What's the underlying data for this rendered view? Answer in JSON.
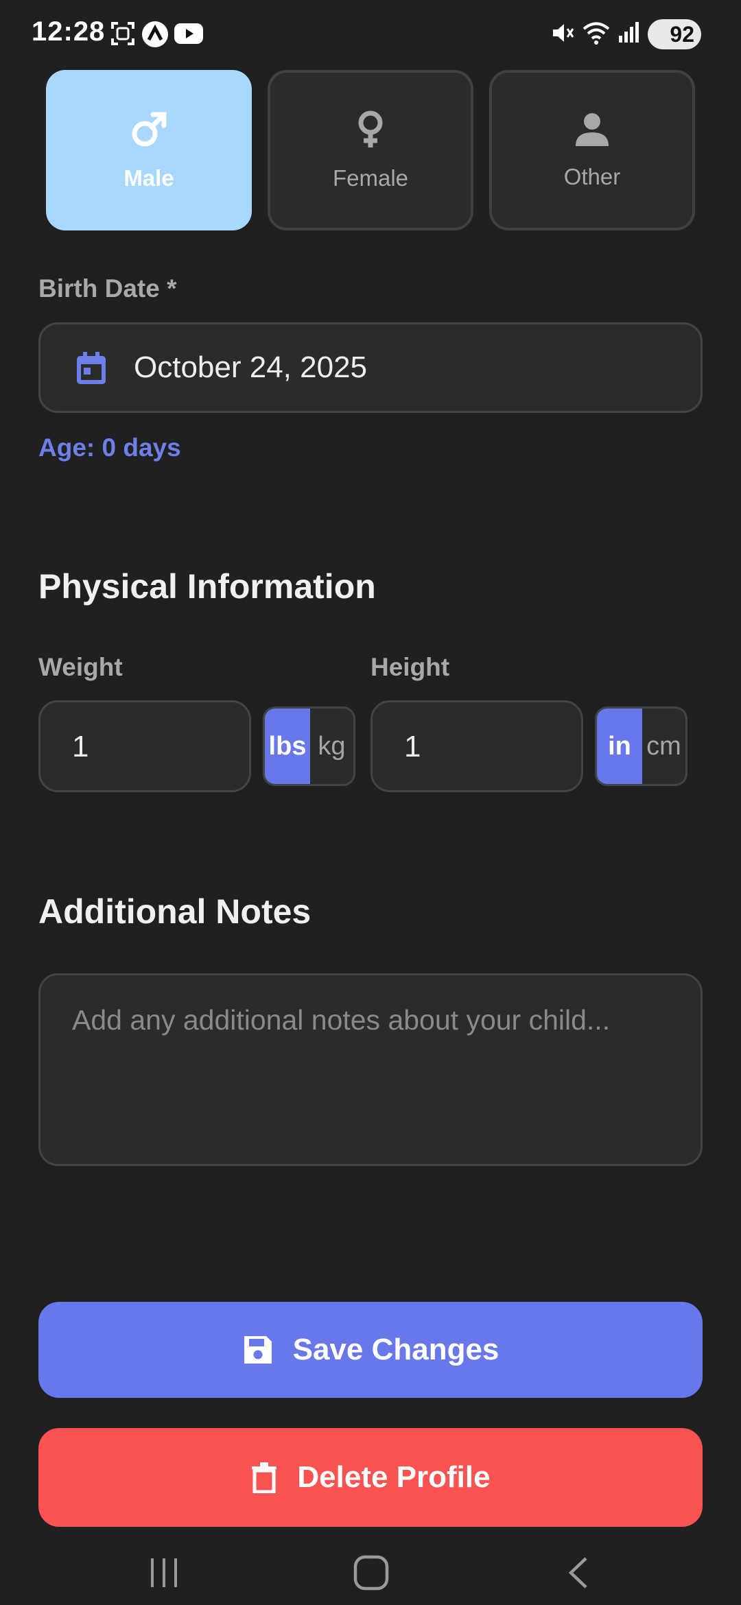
{
  "status_bar": {
    "time": "12:28",
    "battery": "92",
    "icons": [
      "screenshot-icon",
      "app-a-icon",
      "youtube-icon",
      "mute-icon",
      "wifi-icon",
      "signal-icon",
      "battery-icon"
    ]
  },
  "gender": {
    "options": [
      {
        "label": "Male",
        "icon": "male-icon",
        "selected": true
      },
      {
        "label": "Female",
        "icon": "female-icon",
        "selected": false
      },
      {
        "label": "Other",
        "icon": "person-icon",
        "selected": false
      }
    ]
  },
  "birth_date": {
    "label": "Birth Date *",
    "value": "October 24, 2025",
    "age": "Age: 0 days"
  },
  "physical": {
    "title": "Physical Information",
    "weight": {
      "label": "Weight",
      "value": "1",
      "units": [
        "lbs",
        "kg"
      ],
      "selected_unit": "lbs"
    },
    "height": {
      "label": "Height",
      "value": "1",
      "units": [
        "in",
        "cm"
      ],
      "selected_unit": "in"
    }
  },
  "notes": {
    "title": "Additional Notes",
    "placeholder": "Add any additional notes about your child..."
  },
  "actions": {
    "save_label": "Save Changes",
    "delete_label": "Delete Profile"
  },
  "colors": {
    "background": "#202021",
    "accent": "#6878ea",
    "selected_card": "#a8d8ff",
    "danger": "#fb5252"
  }
}
